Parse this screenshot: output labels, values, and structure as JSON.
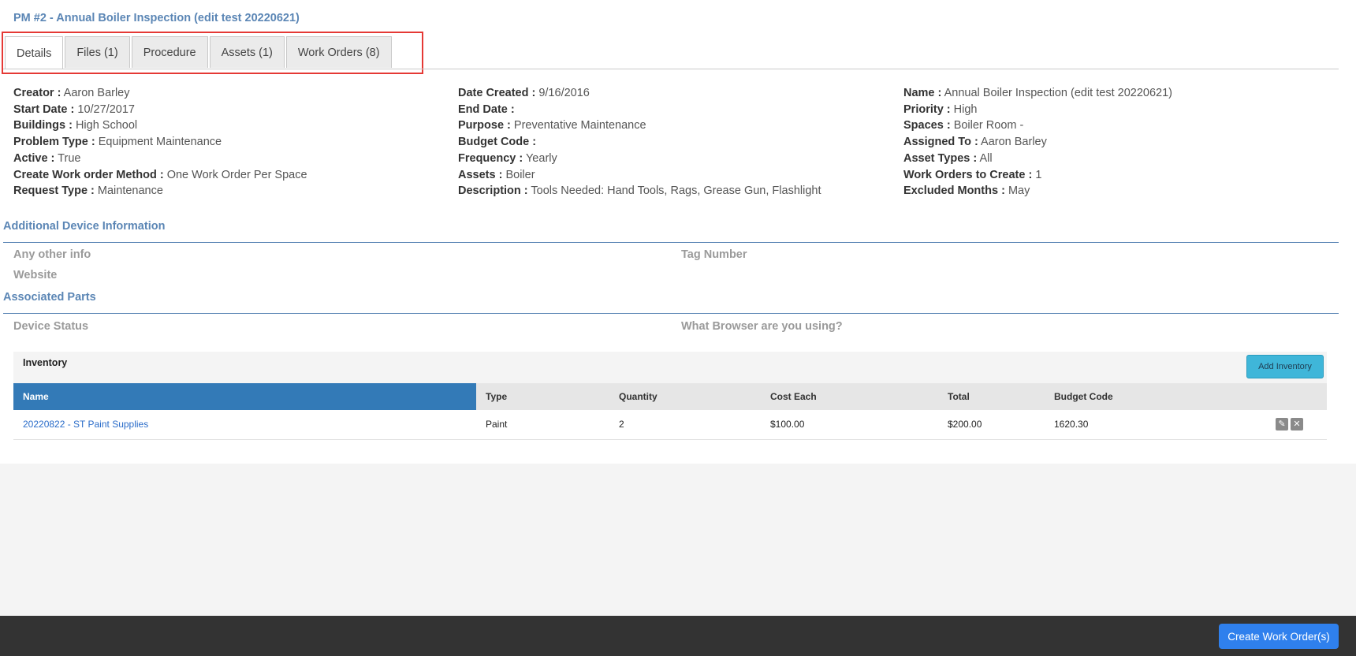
{
  "page": {
    "title": "PM #2 - Annual Boiler Inspection (edit test 20220621)"
  },
  "tabs": [
    {
      "label": "Details",
      "active": true
    },
    {
      "label": "Files (1)",
      "active": false
    },
    {
      "label": "Procedure",
      "active": false
    },
    {
      "label": "Assets (1)",
      "active": false
    },
    {
      "label": "Work Orders (8)",
      "active": false
    }
  ],
  "details": {
    "col1": [
      {
        "label": "Creator :",
        "value": "Aaron Barley"
      },
      {
        "label": "Start Date :",
        "value": "10/27/2017"
      },
      {
        "label": "Buildings :",
        "value": "High School"
      },
      {
        "label": "Problem Type :",
        "value": "Equipment Maintenance"
      },
      {
        "label": "Active :",
        "value": "True"
      },
      {
        "label": "Create Work order Method :",
        "value": "One Work Order Per Space"
      },
      {
        "label": "Request Type :",
        "value": "Maintenance"
      }
    ],
    "col2": [
      {
        "label": "Date Created :",
        "value": "9/16/2016"
      },
      {
        "label": "End Date :",
        "value": ""
      },
      {
        "label": "Purpose :",
        "value": "Preventative Maintenance"
      },
      {
        "label": "Budget Code :",
        "value": ""
      },
      {
        "label": "Frequency :",
        "value": "Yearly"
      },
      {
        "label": "Assets :",
        "value": "Boiler"
      },
      {
        "label": "Description :",
        "value": "Tools Needed: Hand Tools, Rags, Grease Gun, Flashlight"
      }
    ],
    "col3": [
      {
        "label": "Name :",
        "value": "Annual Boiler Inspection (edit test 20220621)"
      },
      {
        "label": "Priority :",
        "value": "High"
      },
      {
        "label": "Spaces :",
        "value": "Boiler Room -"
      },
      {
        "label": "Assigned To :",
        "value": "Aaron Barley"
      },
      {
        "label": "Asset Types :",
        "value": "All"
      },
      {
        "label": "Work Orders to Create :",
        "value": "1"
      },
      {
        "label": "Excluded Months :",
        "value": "May"
      }
    ]
  },
  "additional_device": {
    "title": "Additional Device Information",
    "fields": [
      "Any other info",
      "Tag Number",
      "Website"
    ]
  },
  "associated_parts": {
    "title": "Associated Parts",
    "fields": [
      "Device Status",
      "What Browser are you using?"
    ]
  },
  "inventory": {
    "title": "Inventory",
    "add_button": "Add Inventory",
    "columns": [
      "Name",
      "Type",
      "Quantity",
      "Cost Each",
      "Total",
      "Budget Code"
    ],
    "rows": [
      {
        "name": "20220822 - ST Paint Supplies",
        "type": "Paint",
        "quantity": "2",
        "cost_each": "$100.00",
        "total": "$200.00",
        "budget_code": "1620.30",
        "edit_icon": "pencil-icon",
        "delete_icon": "close-icon"
      }
    ]
  },
  "footer": {
    "create_button": "Create Work Order(s)"
  },
  "colors": {
    "accent_text": "#5b86b5",
    "header_blue": "#337ab7",
    "add_button": "#3fb6d9",
    "create_button": "#2f80ed",
    "footer_bg": "#333333",
    "highlight_outline": "#e53935"
  }
}
